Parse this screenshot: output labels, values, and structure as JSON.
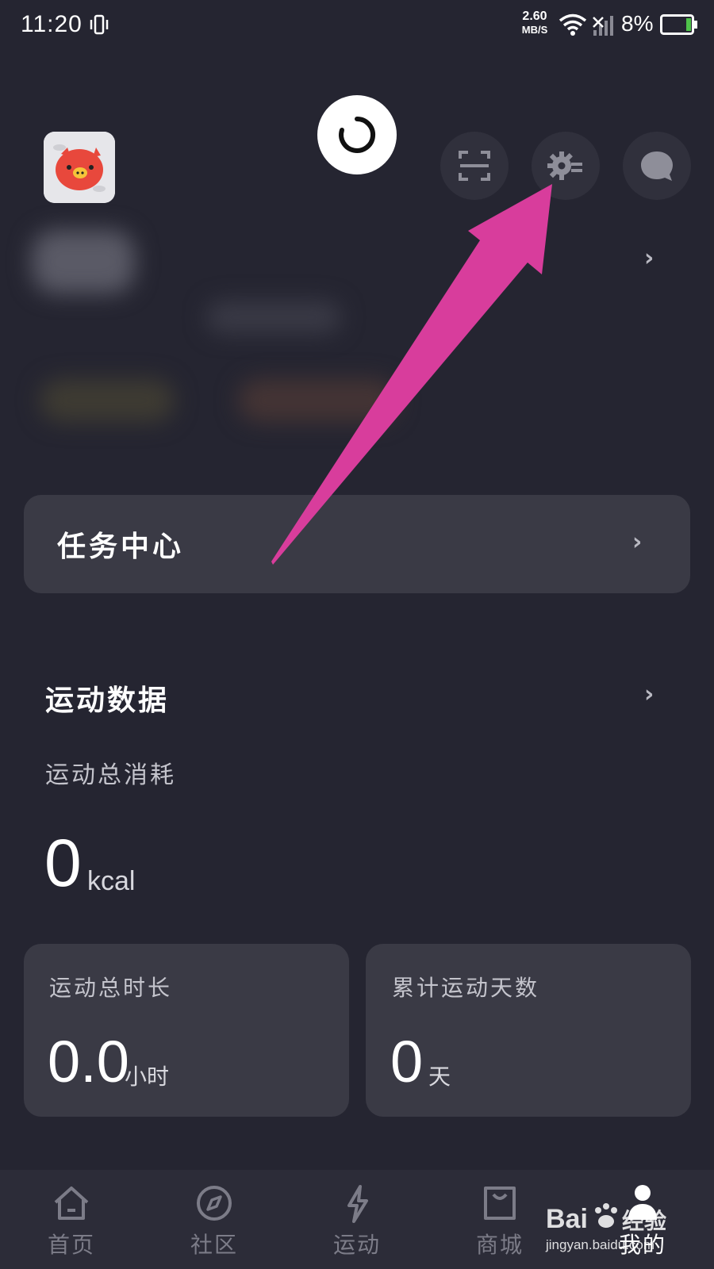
{
  "status_bar": {
    "time": "11:20",
    "net_speed_value": "2.60",
    "net_speed_unit": "MB/S",
    "battery": "8%",
    "battery_level_percent": 8
  },
  "header": {
    "icons": [
      "vibrate-icon",
      "wifi-icon",
      "signal-icon",
      "battery-icon",
      "scan-icon",
      "gear-icon",
      "message-icon"
    ]
  },
  "task_center": {
    "label": "任务中心"
  },
  "sport_data": {
    "title": "运动数据",
    "total_calories_label": "运动总消耗",
    "total_calories_value": "0",
    "total_calories_unit": "kcal",
    "cards": [
      {
        "label": "运动总时长",
        "value": "0.0",
        "unit": "小时"
      },
      {
        "label": "累计运动天数",
        "value": "0",
        "unit": "天"
      }
    ]
  },
  "bottom_nav": {
    "items": [
      {
        "label": "首页",
        "icon": "home-icon",
        "active": false
      },
      {
        "label": "社区",
        "icon": "compass-icon",
        "active": false
      },
      {
        "label": "运动",
        "icon": "lightning-icon",
        "active": false
      },
      {
        "label": "商城",
        "icon": "shopping-bag-icon",
        "active": false
      },
      {
        "label": "我的",
        "icon": "profile-icon",
        "active": true
      }
    ]
  },
  "watermark": {
    "brand": "Bai",
    "brand_cn": "经验",
    "url": "jingyan.baidu.com"
  },
  "colors": {
    "background": "#252531",
    "card": "#3a3a45",
    "annotation_arrow": "#d83d9c"
  }
}
